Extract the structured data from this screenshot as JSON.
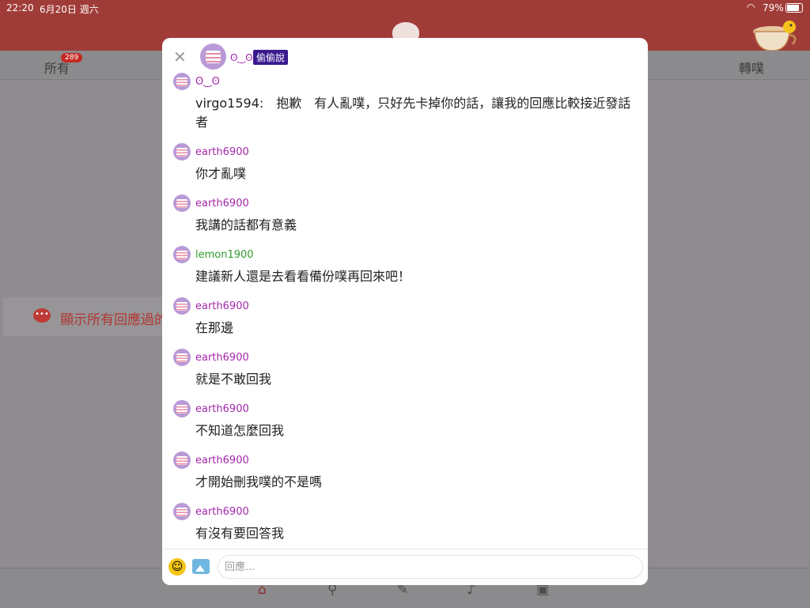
{
  "status_bar": {
    "time": "22:20",
    "date": "6月20日 週六",
    "battery": "79%"
  },
  "tabs": {
    "all_label": "所有",
    "all_count": "289",
    "replurk_label": "轉噗"
  },
  "show_all_label": "顯示所有回應過的",
  "modal": {
    "name": "ʘ‿ʘ",
    "whisper_tag": "偷偷說",
    "reply_placeholder": "回應...",
    "messages": [
      {
        "user": "ʘ‿ʘ",
        "body": "virgo1594:　抱歉　有人亂噗，只好先卡掉你的話，讓我的回應比較接近發話者"
      },
      {
        "user": "earth6900",
        "body": "你才亂噗"
      },
      {
        "user": "earth6900",
        "body": "我講的話都有意義"
      },
      {
        "user": "lemon1900",
        "body": "建議新人還是去看看備份噗再回來吧！"
      },
      {
        "user": "earth6900",
        "body": "在那邊"
      },
      {
        "user": "earth6900",
        "body": "就是不敢回我"
      },
      {
        "user": "earth6900",
        "body": "不知道怎麼回我"
      },
      {
        "user": "earth6900",
        "body": "才開始刪我噗的不是嗎"
      },
      {
        "user": "earth6900",
        "body": "有沒有要回答我"
      }
    ]
  },
  "colors": {
    "header": "#a03c38",
    "user_purple": "#a227aa",
    "user_green": "#2d9c2d",
    "whisper": "#3a1a8e"
  }
}
